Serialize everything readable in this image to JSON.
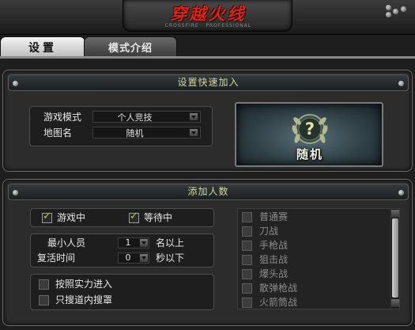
{
  "header": {
    "logo_text": "穿越火线",
    "logo_subtitle": "CROSSFIRE · PROFESSIONAL"
  },
  "tabs": [
    {
      "label": "设置",
      "active": true
    },
    {
      "label": "模式介绍",
      "active": false
    }
  ],
  "quick_join": {
    "title": "设置快速加入",
    "mode_label": "游戏模式",
    "mode_value": "个人竞技",
    "map_label": "地图名",
    "map_value": "随机",
    "random_button_label": "随机",
    "random_button_icon": "question-laurel-icon"
  },
  "add_players": {
    "title": "添加人数",
    "in_game_label": "游戏中",
    "in_game_checked": true,
    "waiting_label": "等待中",
    "waiting_checked": true,
    "min_players_label": "最小人员",
    "min_players_value": "1",
    "min_players_suffix": "名以上",
    "respawn_label": "复活时间",
    "respawn_value": "0",
    "respawn_suffix": "秒以下",
    "skill_label": "按照实力进入",
    "skill_checked": false,
    "channel_label": "只搜道内搜罩",
    "channel_checked": false,
    "modes": [
      "普通赛",
      "刀战",
      "手枪战",
      "狙击战",
      "爆头战",
      "散弹枪战",
      "火箭筒战"
    ]
  },
  "colors": {
    "header_text": "#d2d8a0",
    "logo_red": "#d8271a",
    "check_green": "#a8d050"
  }
}
